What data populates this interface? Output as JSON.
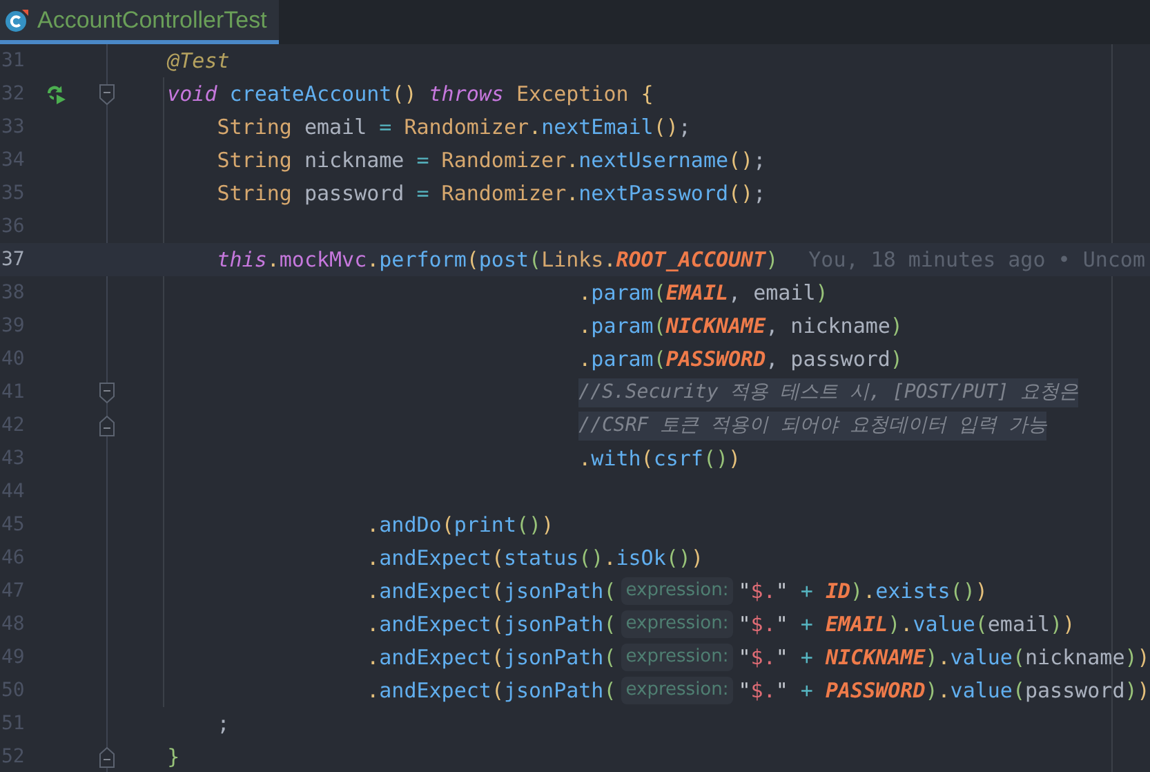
{
  "tab": {
    "title": "AccountControllerTest",
    "selected": true
  },
  "lines": [
    {
      "number": "31",
      "current": false,
      "run": false,
      "tokens": [
        {
          "kind": "ann",
          "text": "    @Test"
        }
      ]
    },
    {
      "number": "32",
      "current": false,
      "run": true,
      "fold": {
        "kind": "start"
      },
      "tokens": [
        {
          "kind": "kw",
          "text": "    void"
        },
        {
          "kind": "fn",
          "text": " createAccount"
        },
        {
          "kind": "p1",
          "text": "()"
        },
        {
          "kind": "kw",
          "text": " throws"
        },
        {
          "kind": "type",
          "text": " Exception"
        },
        {
          "kind": "p1",
          "text": " {"
        }
      ]
    },
    {
      "number": "33",
      "current": false,
      "run": false,
      "tokens": [
        {
          "kind": "type",
          "text": "        String"
        },
        {
          "kind": "id",
          "text": " email "
        },
        {
          "kind": "op",
          "text": "="
        },
        {
          "kind": "type",
          "text": " Randomizer"
        },
        {
          "kind": "dot",
          "text": "."
        },
        {
          "kind": "fn",
          "text": "nextEmail"
        },
        {
          "kind": "p1",
          "text": "()"
        },
        {
          "kind": "punct",
          "text": ";"
        }
      ]
    },
    {
      "number": "34",
      "current": false,
      "run": false,
      "tokens": [
        {
          "kind": "type",
          "text": "        String"
        },
        {
          "kind": "id",
          "text": " nickname "
        },
        {
          "kind": "op",
          "text": "="
        },
        {
          "kind": "type",
          "text": " Randomizer"
        },
        {
          "kind": "dot",
          "text": "."
        },
        {
          "kind": "fn",
          "text": "nextUsername"
        },
        {
          "kind": "p1",
          "text": "()"
        },
        {
          "kind": "punct",
          "text": ";"
        }
      ]
    },
    {
      "number": "35",
      "current": false,
      "run": false,
      "tokens": [
        {
          "kind": "type",
          "text": "        String"
        },
        {
          "kind": "id",
          "text": " password "
        },
        {
          "kind": "op",
          "text": "="
        },
        {
          "kind": "type",
          "text": " Randomizer"
        },
        {
          "kind": "dot",
          "text": "."
        },
        {
          "kind": "fn",
          "text": "nextPassword"
        },
        {
          "kind": "p1",
          "text": "()"
        },
        {
          "kind": "punct",
          "text": ";"
        }
      ]
    },
    {
      "number": "36",
      "current": false,
      "run": false
    },
    {
      "number": "37",
      "current": true,
      "run": false,
      "tokens": [
        {
          "kind": "kw",
          "text": "        this"
        },
        {
          "kind": "dot",
          "text": "."
        },
        {
          "kind": "field",
          "text": "mockMvc"
        },
        {
          "kind": "dot",
          "text": "."
        },
        {
          "kind": "fn",
          "text": "perform"
        },
        {
          "kind": "p1",
          "text": "("
        },
        {
          "kind": "fn",
          "text": "post"
        },
        {
          "kind": "p2",
          "text": "("
        },
        {
          "kind": "type",
          "text": "Links"
        },
        {
          "kind": "dot",
          "text": "."
        },
        {
          "kind": "const",
          "text": "ROOT_ACCOUNT"
        },
        {
          "kind": "p2",
          "text": ")"
        },
        {
          "kind": "blame",
          "text": "You, 18 minutes ago • Uncom"
        }
      ]
    },
    {
      "number": "38",
      "current": false,
      "run": false,
      "tokens": [
        {
          "kind": "dot",
          "text": "                                     ."
        },
        {
          "kind": "fn",
          "text": "param"
        },
        {
          "kind": "p2",
          "text": "("
        },
        {
          "kind": "const",
          "text": "EMAIL"
        },
        {
          "kind": "punct",
          "text": ","
        },
        {
          "kind": "id",
          "text": " email"
        },
        {
          "kind": "p2",
          "text": ")"
        }
      ]
    },
    {
      "number": "39",
      "current": false,
      "run": false,
      "tokens": [
        {
          "kind": "dot",
          "text": "                                     ."
        },
        {
          "kind": "fn",
          "text": "param"
        },
        {
          "kind": "p2",
          "text": "("
        },
        {
          "kind": "const",
          "text": "NICKNAME"
        },
        {
          "kind": "punct",
          "text": ","
        },
        {
          "kind": "id",
          "text": " nickname"
        },
        {
          "kind": "p2",
          "text": ")"
        }
      ]
    },
    {
      "number": "40",
      "current": false,
      "run": false,
      "tokens": [
        {
          "kind": "dot",
          "text": "                                     ."
        },
        {
          "kind": "fn",
          "text": "param"
        },
        {
          "kind": "p2",
          "text": "("
        },
        {
          "kind": "const",
          "text": "PASSWORD"
        },
        {
          "kind": "punct",
          "text": ","
        },
        {
          "kind": "id",
          "text": " password"
        },
        {
          "kind": "p2",
          "text": ")"
        }
      ]
    },
    {
      "number": "41",
      "current": false,
      "run": false,
      "fold": {
        "kind": "start"
      },
      "tokens": [
        {
          "kind": "cm",
          "text": "                                     //S.Security 적용 테스트 시, [POST/PUT] 요청은"
        }
      ]
    },
    {
      "number": "42",
      "current": false,
      "run": false,
      "fold": {
        "kind": "end"
      },
      "tokens": [
        {
          "kind": "cm",
          "text": "                                     //CSRF 토큰 적용이 되어야 요청데이터 입력 가능"
        }
      ]
    },
    {
      "number": "43",
      "current": false,
      "run": false,
      "tokens": [
        {
          "kind": "dot",
          "text": "                                     ."
        },
        {
          "kind": "fn",
          "text": "with"
        },
        {
          "kind": "p1",
          "text": "("
        },
        {
          "kind": "fn",
          "text": "csrf"
        },
        {
          "kind": "p2",
          "text": "()"
        },
        {
          "kind": "p1",
          "text": ")"
        }
      ]
    },
    {
      "number": "44",
      "current": false,
      "run": false
    },
    {
      "number": "45",
      "current": false,
      "run": false,
      "tokens": [
        {
          "kind": "dot",
          "text": "                    ."
        },
        {
          "kind": "fn",
          "text": "andDo"
        },
        {
          "kind": "p1",
          "text": "("
        },
        {
          "kind": "fn",
          "text": "print"
        },
        {
          "kind": "p2",
          "text": "()"
        },
        {
          "kind": "p1",
          "text": ")"
        }
      ]
    },
    {
      "number": "46",
      "current": false,
      "run": false,
      "tokens": [
        {
          "kind": "dot",
          "text": "                    ."
        },
        {
          "kind": "fn",
          "text": "andExpect"
        },
        {
          "kind": "p1",
          "text": "("
        },
        {
          "kind": "fn",
          "text": "status"
        },
        {
          "kind": "p2",
          "text": "()"
        },
        {
          "kind": "dot",
          "text": "."
        },
        {
          "kind": "fn",
          "text": "isOk"
        },
        {
          "kind": "p2",
          "text": "()"
        },
        {
          "kind": "p1",
          "text": ")"
        }
      ]
    },
    {
      "number": "47",
      "current": false,
      "run": false,
      "tokens": [
        {
          "kind": "dot",
          "text": "                    ."
        },
        {
          "kind": "fn",
          "text": "andExpect"
        },
        {
          "kind": "p1",
          "text": "("
        },
        {
          "kind": "fn",
          "text": "jsonPath"
        },
        {
          "kind": "p2",
          "text": "("
        },
        {
          "kind": "hint",
          "text": "expression:"
        },
        {
          "kind": "q",
          "text": "\""
        },
        {
          "kind": "str",
          "text": "$."
        },
        {
          "kind": "q",
          "text": "\""
        },
        {
          "kind": "op",
          "text": " +"
        },
        {
          "kind": "const",
          "text": " ID"
        },
        {
          "kind": "p2",
          "text": ")"
        },
        {
          "kind": "dot",
          "text": "."
        },
        {
          "kind": "fn",
          "text": "exists"
        },
        {
          "kind": "p2",
          "text": "()"
        },
        {
          "kind": "p1",
          "text": ")"
        }
      ]
    },
    {
      "number": "48",
      "current": false,
      "run": false,
      "tokens": [
        {
          "kind": "dot",
          "text": "                    ."
        },
        {
          "kind": "fn",
          "text": "andExpect"
        },
        {
          "kind": "p1",
          "text": "("
        },
        {
          "kind": "fn",
          "text": "jsonPath"
        },
        {
          "kind": "p2",
          "text": "("
        },
        {
          "kind": "hint",
          "text": "expression:"
        },
        {
          "kind": "q",
          "text": "\""
        },
        {
          "kind": "str",
          "text": "$."
        },
        {
          "kind": "q",
          "text": "\""
        },
        {
          "kind": "op",
          "text": " +"
        },
        {
          "kind": "const",
          "text": " EMAIL"
        },
        {
          "kind": "p2",
          "text": ")"
        },
        {
          "kind": "dot",
          "text": "."
        },
        {
          "kind": "fn",
          "text": "value"
        },
        {
          "kind": "p2",
          "text": "("
        },
        {
          "kind": "id",
          "text": "email"
        },
        {
          "kind": "p2",
          "text": ")"
        },
        {
          "kind": "p1",
          "text": ")"
        }
      ]
    },
    {
      "number": "49",
      "current": false,
      "run": false,
      "tokens": [
        {
          "kind": "dot",
          "text": "                    ."
        },
        {
          "kind": "fn",
          "text": "andExpect"
        },
        {
          "kind": "p1",
          "text": "("
        },
        {
          "kind": "fn",
          "text": "jsonPath"
        },
        {
          "kind": "p2",
          "text": "("
        },
        {
          "kind": "hint",
          "text": "expression:"
        },
        {
          "kind": "q",
          "text": "\""
        },
        {
          "kind": "str",
          "text": "$."
        },
        {
          "kind": "q",
          "text": "\""
        },
        {
          "kind": "op",
          "text": " +"
        },
        {
          "kind": "const",
          "text": " NICKNAME"
        },
        {
          "kind": "p2",
          "text": ")"
        },
        {
          "kind": "dot",
          "text": "."
        },
        {
          "kind": "fn",
          "text": "value"
        },
        {
          "kind": "p2",
          "text": "("
        },
        {
          "kind": "id",
          "text": "nickname"
        },
        {
          "kind": "p2",
          "text": ")"
        },
        {
          "kind": "p1",
          "text": ")"
        }
      ]
    },
    {
      "number": "50",
      "current": false,
      "run": false,
      "tokens": [
        {
          "kind": "dot",
          "text": "                    ."
        },
        {
          "kind": "fn",
          "text": "andExpect"
        },
        {
          "kind": "p1",
          "text": "("
        },
        {
          "kind": "fn",
          "text": "jsonPath"
        },
        {
          "kind": "p2",
          "text": "("
        },
        {
          "kind": "hint",
          "text": "expression:"
        },
        {
          "kind": "q",
          "text": "\""
        },
        {
          "kind": "str",
          "text": "$."
        },
        {
          "kind": "q",
          "text": "\""
        },
        {
          "kind": "op",
          "text": " +"
        },
        {
          "kind": "const",
          "text": " PASSWORD"
        },
        {
          "kind": "p2",
          "text": ")"
        },
        {
          "kind": "dot",
          "text": "."
        },
        {
          "kind": "fn",
          "text": "value"
        },
        {
          "kind": "p2",
          "text": "("
        },
        {
          "kind": "id",
          "text": "password"
        },
        {
          "kind": "p2",
          "text": ")"
        },
        {
          "kind": "p1",
          "text": ")"
        }
      ]
    },
    {
      "number": "51",
      "current": false,
      "run": false,
      "tokens": [
        {
          "kind": "punct",
          "text": "        ;"
        }
      ]
    },
    {
      "number": "52",
      "current": false,
      "run": false,
      "fold": {
        "kind": "end"
      },
      "tokens": [
        {
          "kind": "p2",
          "text": "    }"
        }
      ]
    }
  ]
}
